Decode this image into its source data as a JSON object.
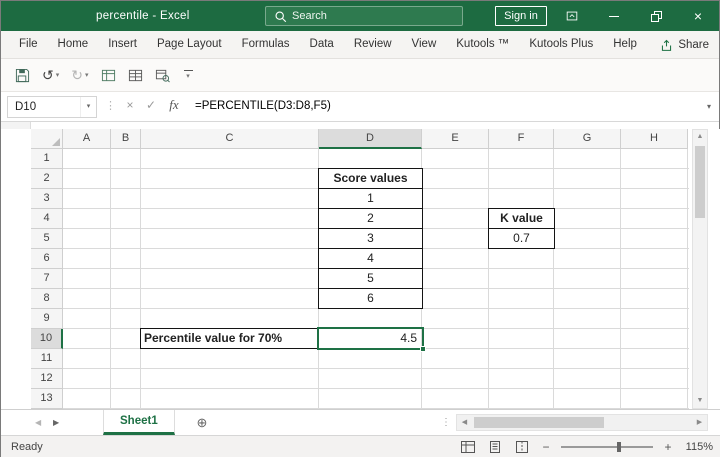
{
  "title_bar": {
    "title": "percentile  -  Excel",
    "search_label": "Search",
    "sign_in_label": "Sign in"
  },
  "ribbon": {
    "tabs": [
      "File",
      "Home",
      "Insert",
      "Page Layout",
      "Formulas",
      "Data",
      "Review",
      "View",
      "Kutools ™",
      "Kutools Plus",
      "Help"
    ],
    "share_label": "Share"
  },
  "formula_bar": {
    "name_box": "D10",
    "fx_label": "fx",
    "formula": "=PERCENTILE(D3:D8,F5)"
  },
  "sheet": {
    "columns": [
      "A",
      "B",
      "C",
      "D",
      "E",
      "F",
      "G",
      "H"
    ],
    "rows": [
      "1",
      "2",
      "3",
      "4",
      "5",
      "6",
      "7",
      "8",
      "9",
      "10",
      "11",
      "12",
      "13"
    ],
    "selected_column": "D",
    "selected_row": "10",
    "selected_cell": "D10",
    "cells": {
      "score_header": "Score values",
      "scores": [
        "1",
        "2",
        "3",
        "4",
        "5",
        "6"
      ],
      "k_header": "K value",
      "k_value": "0.7",
      "percentile_label": "Percentile value for 70%",
      "percentile_value": "4.5"
    }
  },
  "sheet_tabs": {
    "active": "Sheet1"
  },
  "status_bar": {
    "mode": "Ready",
    "zoom": "115%"
  },
  "colors": {
    "title_green": "#1d6b41",
    "accent_green": "#1e7145"
  }
}
